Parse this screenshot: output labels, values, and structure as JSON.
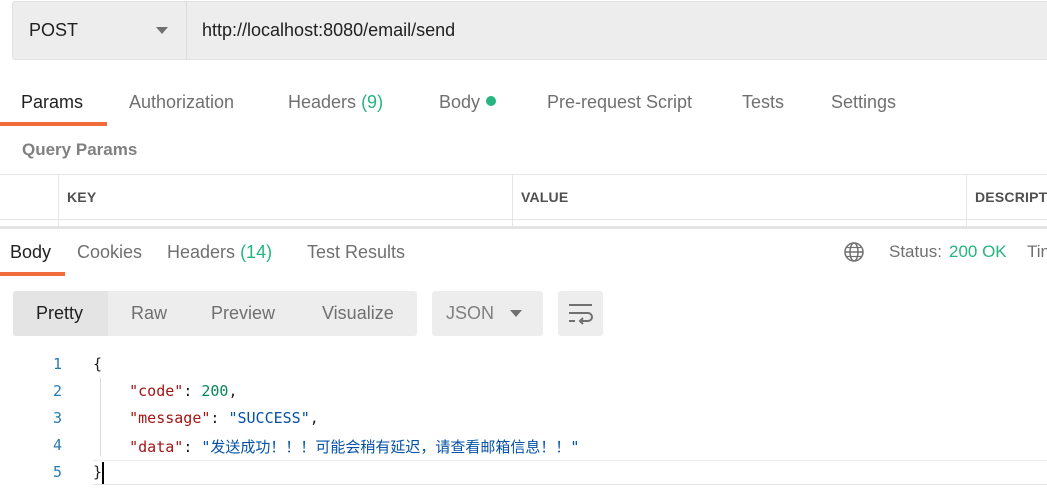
{
  "request": {
    "method": "POST",
    "url": "http://localhost:8080/email/send"
  },
  "request_tabs": [
    {
      "label": "Params",
      "count": ""
    },
    {
      "label": "Authorization",
      "count": ""
    },
    {
      "label": "Headers",
      "count": "(9)"
    },
    {
      "label": "Body",
      "count": ""
    },
    {
      "label": "Pre-request Script",
      "count": ""
    },
    {
      "label": "Tests",
      "count": ""
    },
    {
      "label": "Settings",
      "count": ""
    }
  ],
  "query_params": {
    "title": "Query Params",
    "columns": [
      "KEY",
      "VALUE",
      "DESCRIPTI"
    ]
  },
  "response_tabs": [
    {
      "label": "Body",
      "count": ""
    },
    {
      "label": "Cookies",
      "count": ""
    },
    {
      "label": "Headers",
      "count": "(14)"
    },
    {
      "label": "Test Results",
      "count": ""
    }
  ],
  "status": {
    "label": "Status:",
    "value": "200 OK",
    "time_label": "Tin"
  },
  "format_buttons": [
    "Pretty",
    "Raw",
    "Preview",
    "Visualize"
  ],
  "language": "JSON",
  "code": {
    "line_numbers": [
      "1",
      "2",
      "3",
      "4",
      "5"
    ],
    "open_brace": "{",
    "close_brace": "}",
    "code_key": "\"code\"",
    "code_value": "200",
    "message_key": "\"message\"",
    "message_value": "\"SUCCESS\"",
    "data_key": "\"data\"",
    "data_value": "\"发送成功！！！可能会稍有延迟，请查看邮箱信息！！\""
  },
  "colors": {
    "accent": "#f26b3a",
    "success": "#26b47f",
    "json_key": "#a31515",
    "json_number": "#098658",
    "json_string": "#0451a5"
  },
  "icons": [
    "chevron-down-icon",
    "globe-icon",
    "wrap-lines-icon"
  ]
}
